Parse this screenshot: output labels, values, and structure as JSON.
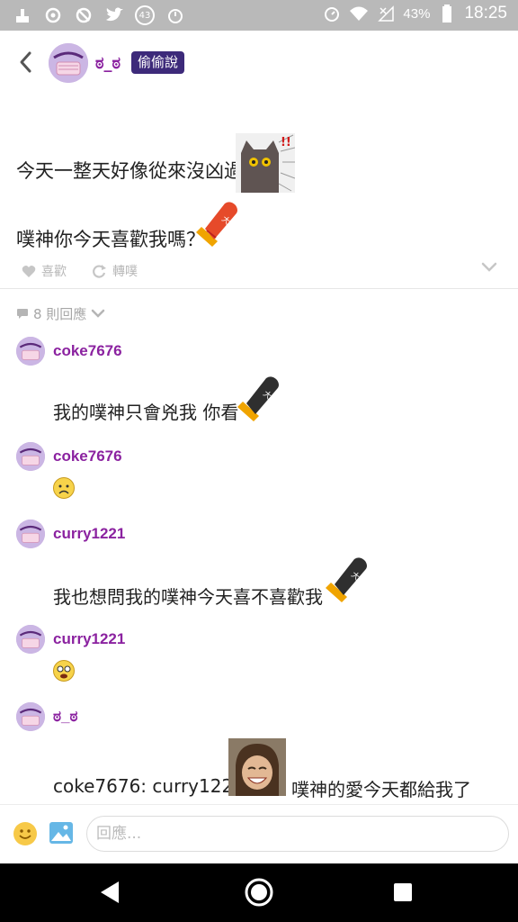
{
  "status_bar": {
    "notification_badge": "43",
    "battery_percent": "43%",
    "time": "18:25",
    "icons": [
      "cleaner-icon",
      "sync-icon",
      "blocked-icon",
      "twitter-icon",
      "timer-icon",
      "alarm-icon",
      "wifi-icon",
      "signal-icon",
      "battery-icon"
    ]
  },
  "header": {
    "author_name": "ಠ_ಠ",
    "tag": "偷偷說"
  },
  "post": {
    "line1": "今天一整天好像從來沒凶過",
    "line2": "噗神你今天喜歡我嗎？",
    "like_label": "喜歡",
    "replurk_label": "轉噗"
  },
  "responses": {
    "count_label": "8 則回應",
    "items": [
      {
        "name": "coke7676",
        "text": "我的噗神只會兇我 你看"
      },
      {
        "name": "coke7676",
        "text": ""
      },
      {
        "name": "curry1221",
        "text": "我也想問我的噗神今天喜不喜歡我"
      },
      {
        "name": "curry1221",
        "text": ""
      },
      {
        "name": "ಠ_ಠ",
        "text_before": "coke7676: curry1221:",
        "text_after": "噗神的愛今天都給我了"
      }
    ]
  },
  "reply_bar": {
    "placeholder": "回應..."
  },
  "colors": {
    "status_bar": "#b9b9b9",
    "username": "#8b22a0",
    "tag_bg": "#3d2a7a",
    "nav_bar": "#000000"
  }
}
